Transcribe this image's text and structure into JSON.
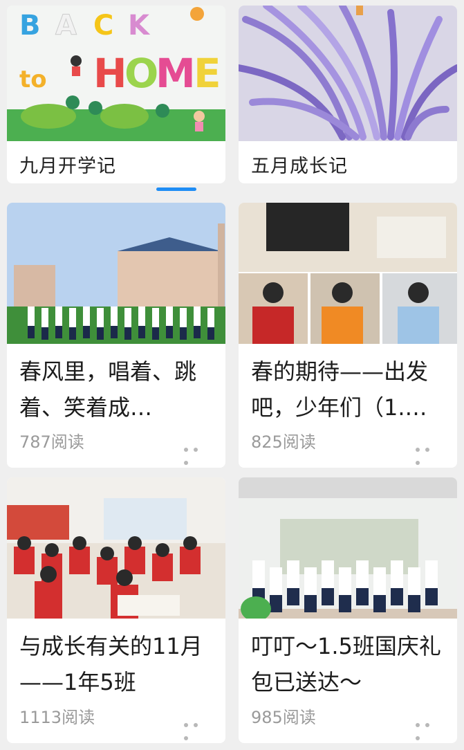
{
  "top_row": [
    {
      "title": "九月开学记",
      "image": "back-to-home-wall-art"
    },
    {
      "title": "五月成长记",
      "image": "purple-paper-craft"
    }
  ],
  "articles": [
    {
      "title": "春风里，唱着、跳着、笑着成…",
      "reads": "787阅读",
      "image": "students-campus-field"
    },
    {
      "title": "春的期待——出发吧，少年们（1.…",
      "reads": "825阅读",
      "image": "students-reading-collage"
    },
    {
      "title": "与成长有关的11月——1年5班",
      "reads": "1113阅读",
      "image": "classroom-students"
    },
    {
      "title": "叮叮～1.5班国庆礼包已送达～",
      "reads": "985阅读",
      "image": "class-group-photo"
    }
  ],
  "icons": {
    "more": "more-dots-icon"
  },
  "colors": {
    "indicator": "#1f8df5",
    "background": "#efefef"
  }
}
